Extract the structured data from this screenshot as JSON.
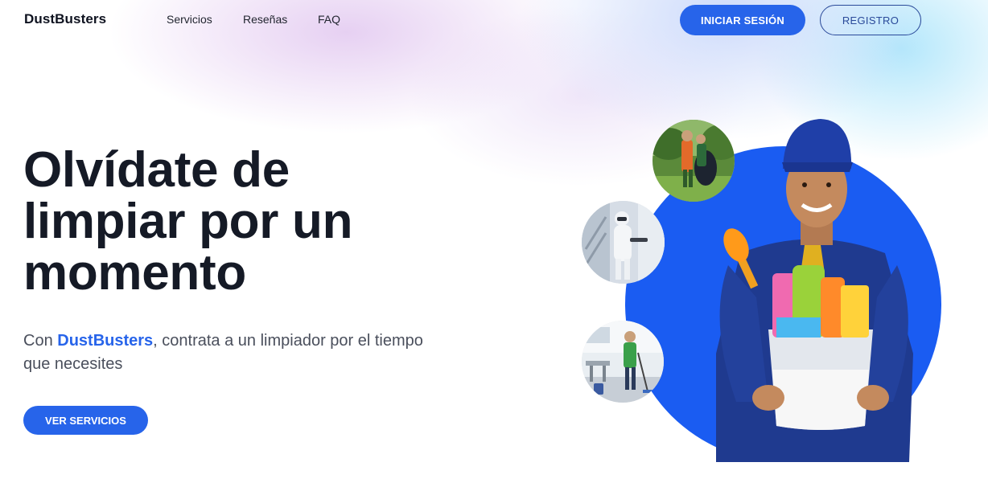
{
  "nav": {
    "logo": "DustBusters",
    "links": [
      "Servicios",
      "Reseñas",
      "FAQ"
    ],
    "login_label": "INICIAR SESIÓN",
    "register_label": "REGISTRO"
  },
  "hero": {
    "title_lines": [
      "Olvídate de",
      "limpiar por un",
      "momento"
    ],
    "subtitle_prefix": "Con ",
    "subtitle_brand": "DustBusters",
    "subtitle_suffix": ", contrata a un limpiador por el tiempo que necesites",
    "cta_label": "VER SERVICIOS"
  },
  "images": {
    "thumbs": [
      "garden-cleaning-photo",
      "disinfection-worker-photo",
      "office-cleaning-photo"
    ],
    "main": "cleaner-with-bucket-photo"
  },
  "colors": {
    "accent": "#2764ea",
    "circle": "#1a5cf2",
    "text_dark": "#151a26"
  }
}
